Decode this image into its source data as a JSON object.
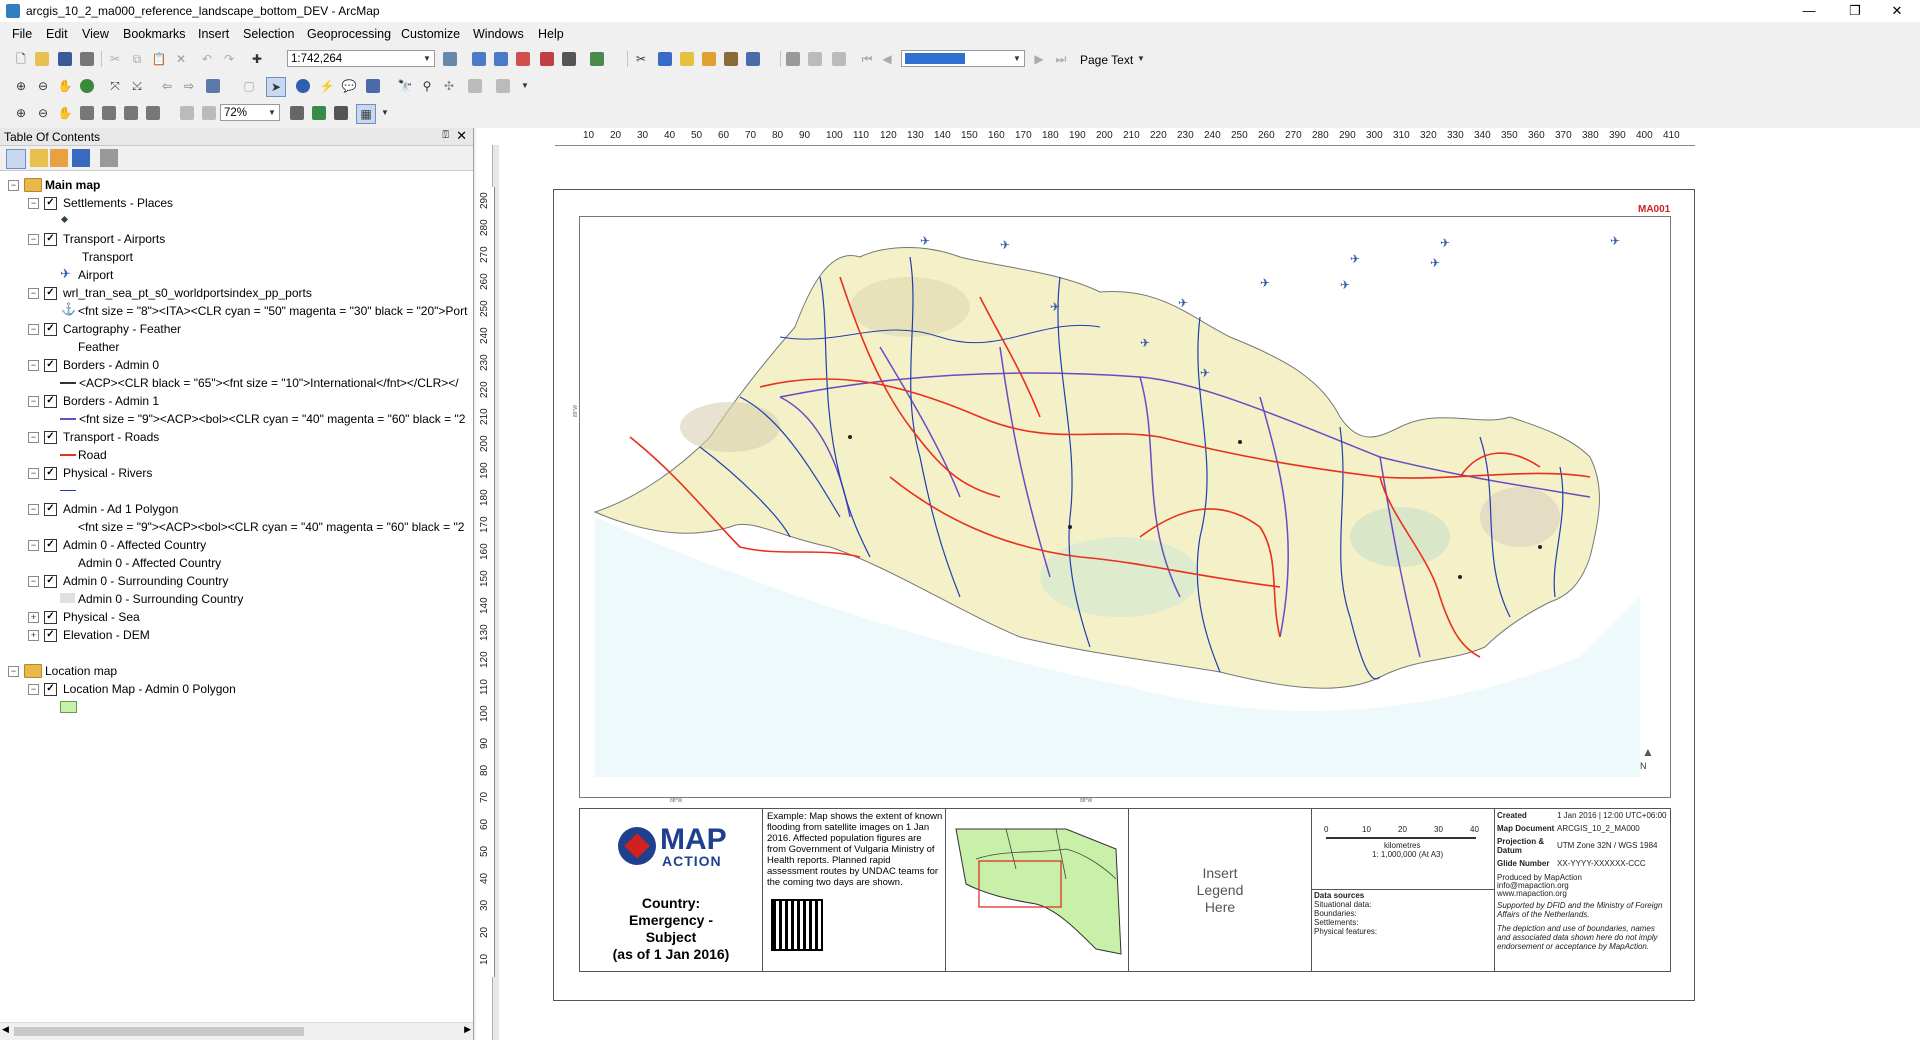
{
  "window": {
    "title": "arcgis_10_2_ma000_reference_landscape_bottom_DEV - ArcMap",
    "minimize": "—",
    "restore": "❐",
    "close": "✕"
  },
  "menu": [
    "File",
    "Edit",
    "View",
    "Bookmarks",
    "Insert",
    "Selection",
    "Geoprocessing",
    "Customize",
    "Windows",
    "Help"
  ],
  "toolbar": {
    "scale": "1:742,264",
    "zoom_percent": "72%",
    "page_text": "Page Text"
  },
  "toc": {
    "title": "Table Of Contents",
    "pin": "⍔",
    "close": "✕",
    "main_frame": "Main map",
    "layers": [
      {
        "name": "Settlements - Places",
        "legend": ""
      },
      {
        "name": "Transport - Airports",
        "legend": "Transport",
        "legend2": "Airport"
      },
      {
        "name": "wrl_tran_sea_pt_s0_worldportsindex_pp_ports",
        "legend": "<fnt size = \"8\"><ITA><CLR cyan = \"50\" magenta = \"30\" black = \"20\">Port"
      },
      {
        "name": "Cartography - Feather",
        "legend": "Feather"
      },
      {
        "name": "Borders - Admin 0",
        "legend": "<ACP><CLR black = \"65\"><fnt size = \"10\">International</fnt></CLR></"
      },
      {
        "name": "Borders - Admin 1",
        "legend": "<fnt size = \"9\"><ACP><bol><CLR cyan = \"40\" magenta = \"60\" black = \"2"
      },
      {
        "name": "Transport - Roads",
        "legend": "Road"
      },
      {
        "name": "Physical - Rivers",
        "legend": ""
      },
      {
        "name": "Admin - Ad 1 Polygon",
        "legend": "<fnt size = \"9\"><ACP><bol><CLR cyan = \"40\" magenta = \"60\" black = \"2"
      },
      {
        "name": "Admin 0 - Affected Country",
        "legend": "Admin 0 - Affected Country"
      },
      {
        "name": "Admin 0 - Surrounding Country",
        "legend": "Admin 0 - Surrounding Country"
      },
      {
        "name": "Physical - Sea",
        "legend": ""
      },
      {
        "name": "Elevation - DEM",
        "legend": ""
      }
    ],
    "location_frame": "Location map",
    "location_layers": [
      {
        "name": "Location Map - Admin 0 Polygon"
      }
    ]
  },
  "ruler": {
    "h": [
      "10",
      "20",
      "30",
      "40",
      "50",
      "60",
      "70",
      "80",
      "90",
      "100",
      "110",
      "120",
      "130",
      "140",
      "150",
      "160",
      "170",
      "180",
      "190",
      "200",
      "210",
      "220",
      "230",
      "240",
      "250",
      "260",
      "270",
      "280",
      "290",
      "300",
      "310",
      "320",
      "330",
      "340",
      "350",
      "360",
      "370",
      "380",
      "390",
      "400",
      "410"
    ],
    "v": [
      "290",
      "280",
      "270",
      "260",
      "250",
      "240",
      "230",
      "220",
      "210",
      "200",
      "190",
      "180",
      "170",
      "160",
      "150",
      "140",
      "130",
      "120",
      "110",
      "100",
      "90",
      "80",
      "70",
      "60",
      "50",
      "40",
      "30",
      "20",
      "10"
    ]
  },
  "map": {
    "code": "MA001",
    "north": "N",
    "coord_top": "89°W",
    "coord_bottom_1": "88°W",
    "coord_bottom_2": "88°W"
  },
  "marginalia": {
    "logo_line1": "MAP",
    "logo_line2": "ACTION",
    "title_lines": [
      "Country:",
      "Emergency -",
      "Subject",
      "(as of 1 Jan 2016)"
    ],
    "description": "Example: Map shows the extent of known flooding from satellite images on 1 Jan 2016. Affected population figures are from Government of Vulgaria Ministry of Health reports. Planned rapid assessment routes by UNDAC teams for the coming two days are shown.",
    "legend_placeholder": [
      "Insert",
      "Legend",
      "Here"
    ],
    "scale_ticks": [
      "0",
      "10",
      "20",
      "30",
      "40"
    ],
    "scale_unit": "kilometres",
    "scale_text": "1: 1,000,000 (At A3)",
    "data_sources_title": "Data sources",
    "data_sources": [
      "Situational data:",
      "Boundaries:",
      "Settlements:",
      "Physical features:"
    ],
    "meta": [
      {
        "k": "Created",
        "v": "1 Jan 2016 | 12:00 UTC+06:00"
      },
      {
        "k": "Map Document",
        "v": "ARCGIS_10_2_MA000"
      },
      {
        "k": "Projection & Datum",
        "v": "UTM Zone 32N / WGS 1984"
      },
      {
        "k": "Glide Number",
        "v": "XX-YYYY-XXXXXX-CCC"
      }
    ],
    "produced": [
      "Produced by MapAction",
      "info@mapaction.org",
      "www.mapaction.org"
    ],
    "supported": "Supported by DFID and the Ministry of Foreign Affairs of the Netherlands.",
    "disclaimer": "The depiction and use of boundaries, names and associated data shown here do not imply endorsement or acceptance by MapAction."
  },
  "colors": {
    "road": "#e8301c",
    "river": "#1f3fb0",
    "admin1": "#6a4bc4",
    "affected": "#f4f1c8",
    "sea": "#c8ecf2",
    "location_green": "#c8f0a8"
  }
}
